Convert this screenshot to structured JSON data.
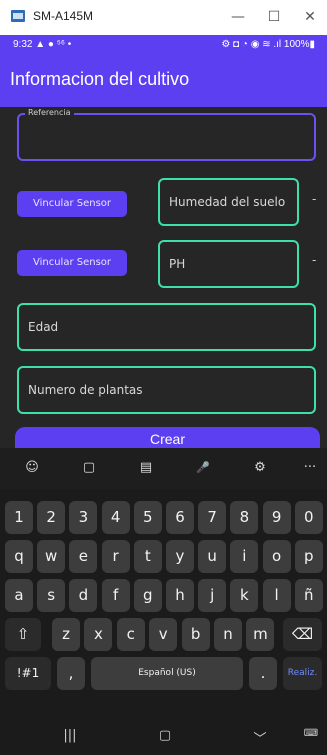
{
  "window": {
    "title": "SM-A145M",
    "minimize": "—",
    "maximize": "☐",
    "close": "✕"
  },
  "status": {
    "time": "9:32",
    "left_icons": "▲ ● ⁵⁶ •",
    "right_icons": "⚙ ◘ ◔ ◉ ≋ .ıl 100%▮"
  },
  "appbar": {
    "title": "Informacion del cultivo"
  },
  "form": {
    "reference_label": "Referencia",
    "link_sensor_1": "Vincular Sensor",
    "humidity_label": "Humedad del suelo",
    "dash_1": "-",
    "link_sensor_2": "Vincular Sensor",
    "ph_label": "PH",
    "dash_2": "-",
    "age_label": "Edad",
    "plants_label": "Numero de plantas",
    "create_button": "Crear"
  },
  "keyboard": {
    "toolbar": [
      "☺",
      "▢",
      "▤",
      "🎤",
      "⚙",
      "···"
    ],
    "row_numbers": [
      "1",
      "2",
      "3",
      "4",
      "5",
      "6",
      "7",
      "8",
      "9",
      "0"
    ],
    "row_1": [
      "q",
      "w",
      "e",
      "r",
      "t",
      "y",
      "u",
      "i",
      "o",
      "p"
    ],
    "row_2": [
      "a",
      "s",
      "d",
      "f",
      "g",
      "h",
      "j",
      "k",
      "l",
      "ñ"
    ],
    "row_3": [
      "z",
      "x",
      "c",
      "v",
      "b",
      "n",
      "m"
    ],
    "shift": "⇧",
    "backspace": "⌫",
    "symbols": "!#1",
    "comma": ",",
    "space": "Español (US)",
    "period": ".",
    "action": "Realiz."
  },
  "nav": {
    "recents": "|||",
    "home": "▢",
    "back": "﹀",
    "keyboard": "⌨"
  }
}
